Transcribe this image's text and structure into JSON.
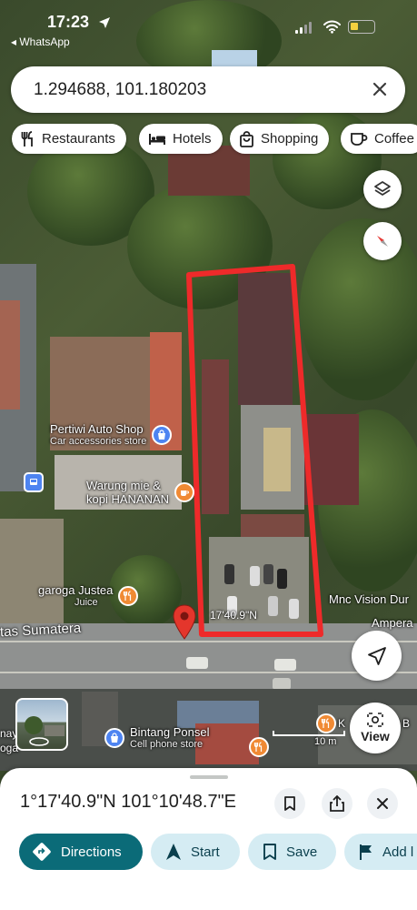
{
  "status_bar": {
    "time": "17:23",
    "back_app": "◂ WhatsApp"
  },
  "search": {
    "query": "1.294688, 101.180203",
    "clear_icon": "close-icon"
  },
  "chips": [
    {
      "label": "Restaurants",
      "icon": "fork-knife-icon"
    },
    {
      "label": "Hotels",
      "icon": "bed-icon"
    },
    {
      "label": "Shopping",
      "icon": "shopping-bag-icon"
    },
    {
      "label": "Coffee",
      "icon": "coffee-icon"
    }
  ],
  "map": {
    "pois": [
      {
        "name": "Pertiwi Auto Shop",
        "category": "Car accessories store",
        "icon": "shopping-bag-icon",
        "color": "#4e84f1"
      },
      {
        "name": "Warung mie &",
        "name2": "kopi HANANAN",
        "icon": "coffee-icon",
        "color": "#f08a34"
      },
      {
        "name": "garoga Justea",
        "category": "Juice",
        "icon": "fork-knife-icon",
        "color": "#f08a34"
      },
      {
        "name": "Bintang Ponsel",
        "category": "Cell phone store",
        "icon": "shopping-bag-icon",
        "color": "#4e84f1"
      }
    ],
    "pin_label": "17'40.9\"N",
    "road_label": "tas Sumatera",
    "side_labels": {
      "mnc": "Mnc Vision Dur",
      "ampera": "Ampera",
      "k_label": "K",
      "b_label": "i B",
      "nay": "nay",
      "oga": "oga",
      "scale": "10 m"
    },
    "highlight_color": "#ee2a2a",
    "pin_color": "#e4362c"
  },
  "controls": {
    "view_label": "View"
  },
  "sheet": {
    "title": "1°17'40.9\"N 101°10'48.7\"E",
    "actions": [
      {
        "label": "Directions",
        "icon": "directions-icon",
        "primary": true
      },
      {
        "label": "Start",
        "icon": "navigation-arrow-icon"
      },
      {
        "label": "Save",
        "icon": "bookmark-icon"
      },
      {
        "label": "Add l",
        "icon": "flag-icon"
      }
    ]
  }
}
